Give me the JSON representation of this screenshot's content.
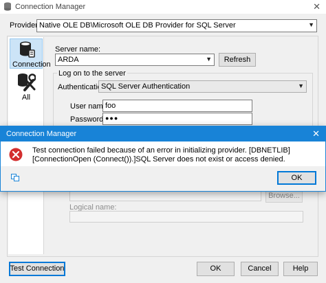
{
  "window": {
    "title": "Connection Manager",
    "close_glyph": "✕"
  },
  "provider": {
    "label": "Provider:",
    "value": "Native OLE DB\\Microsoft OLE DB Provider for SQL Server"
  },
  "sidebar": {
    "items": [
      {
        "label": "Connection",
        "icon": "connection-icon"
      },
      {
        "label": "All",
        "icon": "tools-icon"
      }
    ]
  },
  "server": {
    "label": "Server name:",
    "value": "ARDA",
    "refresh_label": "Refresh"
  },
  "logon": {
    "group_label": "Log on to the server",
    "auth_label": "Authentication:",
    "auth_value": "SQL Server Authentication",
    "username_label": "User name:",
    "username_value": "foo",
    "password_label": "Password:",
    "password_value": "●●●"
  },
  "database": {
    "browse_label": "Browse...",
    "logical_name_label": "Logical name:"
  },
  "footer": {
    "test_label": "Test Connection",
    "ok_label": "OK",
    "cancel_label": "Cancel",
    "help_label": "Help"
  },
  "error_dialog": {
    "title": "Connection Manager",
    "message": "Test connection failed because of an error in initializing provider. [DBNETLIB][ConnectionOpen (Connect()).]SQL Server does not exist or access denied.",
    "ok_label": "OK",
    "close_glyph": "✕"
  },
  "colors": {
    "accent": "#1883d7",
    "error": "#d32f2f"
  }
}
